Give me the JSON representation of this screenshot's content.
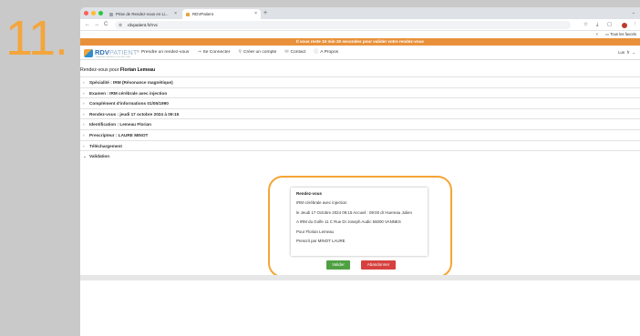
{
  "step": {
    "number": "11."
  },
  "browser": {
    "tabs": [
      {
        "label": "Prise de Rendez-vous en Li...",
        "close": "×"
      },
      {
        "label": "RDVPatient",
        "close": "×"
      }
    ],
    "new_tab": "+",
    "tabs_menu": "⌄",
    "nav": {
      "back": "←",
      "forward": "→",
      "reload": "C"
    },
    "url": "rdvpatient.fr/rrvc",
    "toolbar_icons": [
      "☆",
      "⤓",
      "▢",
      "⋮"
    ],
    "bookmarks": {
      "close": "×",
      "all_bookmarks": "Tous les favoris"
    }
  },
  "app": {
    "banner": "Il vous reste 10 min 20 secondes pour valider votre rendez-vous",
    "logo": {
      "rdv": "RDV",
      "patient": "PATIENT",
      "sub": "PRENDRE RENDEZ-VOUS EN LIGNE"
    },
    "nav_items": [
      {
        "icon": "≡",
        "label": "Prendre un rendez-vous"
      },
      {
        "icon": "⇥",
        "label": "Se Connecter"
      },
      {
        "icon": "⚲",
        "label": "Créer un compte"
      },
      {
        "icon": "✉",
        "label": "Contact"
      },
      {
        "icon": "ⓘ",
        "label": "A Propos"
      }
    ],
    "lang": {
      "left": "Lus",
      "right": "fr"
    },
    "page_title": {
      "prefix": "Rendez-vous pour",
      "name": "Florian Lemeau"
    },
    "accordion": [
      {
        "chevron": "›",
        "label": "Spécialité : IRM (Résonance magnétique)"
      },
      {
        "chevron": "›",
        "label": "Examen : IRM cérébrale avec injection"
      },
      {
        "chevron": "›",
        "label": "Complément d'informations 01/05/1990"
      },
      {
        "chevron": "›",
        "label": "Rendez-vous : jeudi 17 octobre 2024 à 09:15"
      },
      {
        "chevron": "›",
        "label": "Identification : Lemeau Florian"
      },
      {
        "chevron": "›",
        "label": "Prescripteur : LAURE MINOT"
      },
      {
        "chevron": "›",
        "label": "Téléchargement"
      },
      {
        "chevron": "⌄",
        "label": "Validation"
      }
    ],
    "summary": {
      "title": "Rendez-vous",
      "lines": [
        "IRM cérébrale avec injection",
        "le Jeudi 17 Octobre 2024 09:15 Accueil : 09:00 dr Huereau Julien",
        "A IRM du Golfe 11 C Rue Dr Joseph Audic 56000 VANNES",
        "Pour Florian Lemeau",
        "Prescrit par MINOT LAURE"
      ]
    },
    "buttons": {
      "validate": "Valider",
      "abandon": "Abandonner"
    }
  },
  "colors": {
    "accent_orange": "#f4a63c",
    "banner": "#e8913a",
    "validate": "#4fa042",
    "abandon": "#d64140",
    "brand_blue": "#2e6fb5"
  }
}
